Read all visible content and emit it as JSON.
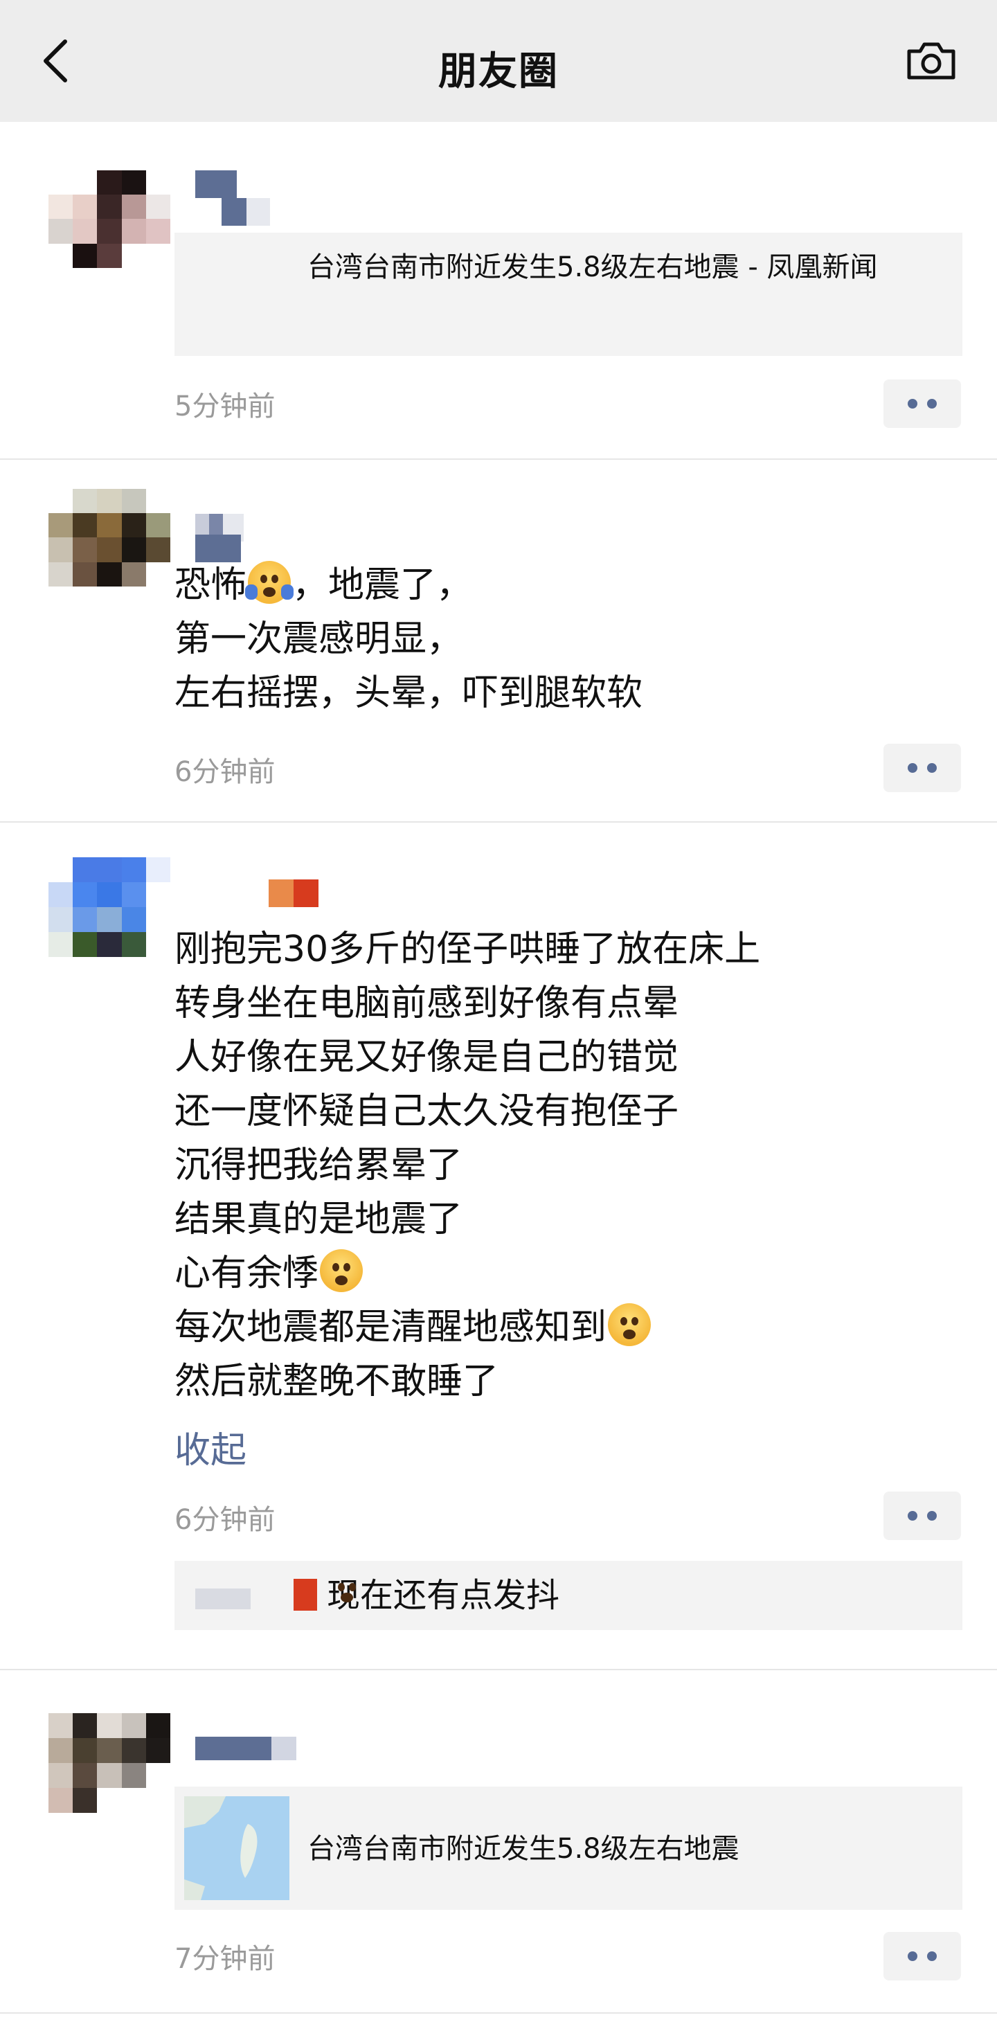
{
  "header": {
    "title": "朋友圈",
    "back_icon": "chevron-left-icon",
    "camera_icon": "camera-icon"
  },
  "posts": [
    {
      "link_title": "台湾台南市附近发生5.8级左右地震 - 凤凰新闻",
      "time": "5分钟前"
    },
    {
      "lines": [
        "恐怖",
        "，地震了，",
        "第一次震感明显，",
        "左右摇摆，头晕，吓到腿软软"
      ],
      "time": "6分钟前"
    },
    {
      "lines": [
        "刚抱完30多斤的侄子哄睡了放在床上",
        "转身坐在电脑前感到好像有点晕",
        "人好像在晃又好像是自己的错觉",
        "还一度怀疑自己太久没有抱侄子",
        "沉得把我给累晕了",
        "结果真的是地震了",
        "心有余悸",
        "每次地震都是清醒地感知到",
        "然后就整晚不敢睡了"
      ],
      "collapse": "收起",
      "time": "6分钟前",
      "comment": "现在还有点发抖"
    },
    {
      "link_title": "台湾台南市附近发生5.8级左右地震",
      "time": "7分钟前"
    }
  ],
  "colors": {
    "header_bg": "#ededed",
    "link_blue": "#576b95",
    "time_gray": "#9a9a9a",
    "card_bg": "#f3f3f3"
  }
}
